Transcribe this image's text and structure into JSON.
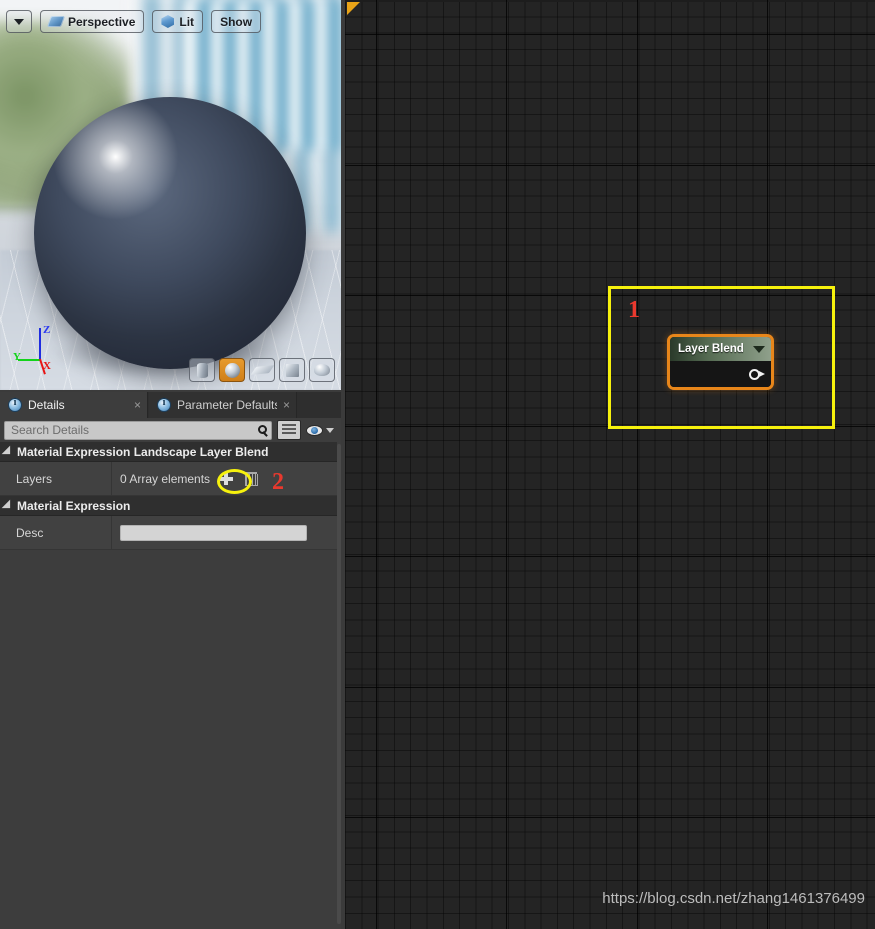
{
  "viewport": {
    "toolbar": {
      "dropdown_label": "",
      "dropdown_icon": "chevron-down-icon",
      "perspective_label": "Perspective",
      "perspective_icon": "perspective-icon",
      "lit_label": "Lit",
      "lit_icon": "cube-icon",
      "show_label": "Show"
    },
    "gizmo": {
      "z": "Z",
      "y": "Y",
      "x": "X"
    },
    "mesh_buttons": [
      {
        "name": "cylinder-preview",
        "active": false
      },
      {
        "name": "sphere-preview",
        "active": true
      },
      {
        "name": "plane-preview",
        "active": false
      },
      {
        "name": "cube-preview",
        "active": false
      },
      {
        "name": "teapot-preview",
        "active": false
      }
    ]
  },
  "details": {
    "tabs": [
      {
        "label": "Details",
        "icon": "info-icon",
        "active": true,
        "close": "×"
      },
      {
        "label": "Parameter Defaults",
        "icon": "info-icon",
        "active": false,
        "close": "×"
      }
    ],
    "search": {
      "placeholder": "Search Details",
      "value": "",
      "icon": "search-icon"
    },
    "view_toggle_icon": "grid-view-icon",
    "eye_icon": "eye-icon",
    "eye_dropdown_icon": "chevron-down-icon",
    "categories": [
      {
        "title": "Material Expression Landscape Layer Blend",
        "rows": [
          {
            "name": "Layers",
            "value": "0 Array elements",
            "add_icon": "plus-icon",
            "delete_icon": "trash-icon"
          }
        ]
      },
      {
        "title": "Material Expression",
        "rows": [
          {
            "name": "Desc",
            "value": "",
            "placeholder": ""
          }
        ]
      }
    ]
  },
  "graph": {
    "node": {
      "title": "Layer Blend",
      "chevron_icon": "chevron-down-icon",
      "output_pin_icon": "output-pin-icon"
    },
    "watermark": "https://blog.csdn.net/zhang1461376499"
  },
  "annotations": [
    {
      "id": "annotation-1",
      "label": "1",
      "shape": "rectangle",
      "color": "#f6f10d",
      "text_color": "#e8392e"
    },
    {
      "id": "annotation-2",
      "label": "2",
      "shape": "ellipse",
      "color": "#f6f10d",
      "text_color": "#e8392e"
    }
  ]
}
